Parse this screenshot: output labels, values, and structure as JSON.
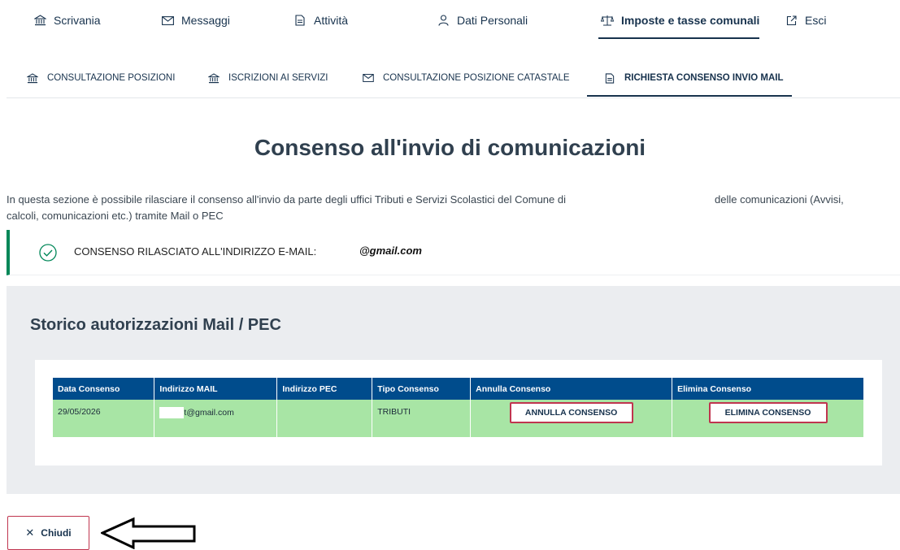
{
  "top_nav": {
    "items": [
      {
        "label": "Scrivania",
        "icon": "bank-icon"
      },
      {
        "label": "Messaggi",
        "icon": "envelope-icon"
      },
      {
        "label": "Attività",
        "icon": "document-icon"
      },
      {
        "label": "Dati Personali",
        "icon": "user-icon"
      },
      {
        "label": "Imposte e tasse comunali",
        "icon": "scales-icon",
        "active": true
      },
      {
        "label": "Esci",
        "icon": "external-link-icon"
      }
    ]
  },
  "sub_nav": {
    "items": [
      {
        "label": "CONSULTAZIONE POSIZIONI",
        "icon": "bank-icon"
      },
      {
        "label": "ISCRIZIONI AI SERVIZI",
        "icon": "bank-icon"
      },
      {
        "label": "CONSULTAZIONE POSIZIONE CATASTALE",
        "icon": "envelope-icon"
      },
      {
        "label": "RICHIESTA CONSENSO INVIO MAIL",
        "icon": "document-icon",
        "active": true
      }
    ]
  },
  "page": {
    "title": "Consenso all'invio di comunicazioni",
    "intro_part1": "In questa sezione è possibile rilasciare il consenso all'invio da parte degli uffici Tributi e Servizi Scolastici del Comune di",
    "intro_part2": "delle comunicazioni (Avvisi,",
    "intro_line2": "calcoli, comunicazioni etc.) tramite Mail o PEC"
  },
  "alert": {
    "text": "CONSENSO RILASCIATO ALL'INDIRIZZO E-MAIL:",
    "email": "@gmail.com",
    "icon": "check-circle-icon",
    "color": "#008758"
  },
  "history": {
    "title": "Storico autorizzazioni Mail / PEC",
    "columns": [
      "Data Consenso",
      "Indirizzo MAIL",
      "Indirizzo PEC",
      "Tipo Consenso",
      "Annulla Consenso",
      "Elimina Consenso"
    ],
    "rows": [
      {
        "data": "29/05/2026",
        "mail": "t@gmail.com",
        "pec": "",
        "tipo": "TRIBUTI",
        "annulla_label": "ANNULLA CONSENSO",
        "elimina_label": "ELIMINA CONSENSO"
      }
    ]
  },
  "close_button": {
    "label": "Chiudi",
    "icon": "close-icon"
  },
  "colors": {
    "header_blue": "#004c8c",
    "row_green": "#a8e5a5",
    "button_border": "#c0354f",
    "nav_text": "#17324d"
  }
}
